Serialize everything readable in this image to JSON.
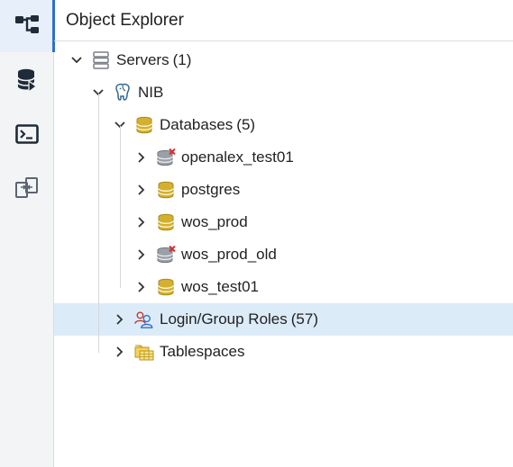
{
  "rail": {
    "buttons": [
      {
        "name": "object-explorer-icon",
        "active": true
      },
      {
        "name": "query-database-icon",
        "active": false
      },
      {
        "name": "terminal-icon",
        "active": false
      },
      {
        "name": "schema-diff-icon",
        "active": false
      }
    ]
  },
  "panel": {
    "title": "Object Explorer"
  },
  "tree": {
    "servers": {
      "label": "Servers",
      "count": "(1)"
    },
    "server": {
      "label": "NIB"
    },
    "databases": {
      "label": "Databases",
      "count": "(5)"
    },
    "db_items": [
      {
        "label": "openalex_test01",
        "disconnected": true
      },
      {
        "label": "postgres",
        "disconnected": false
      },
      {
        "label": "wos_prod",
        "disconnected": false
      },
      {
        "label": "wos_prod_old",
        "disconnected": true
      },
      {
        "label": "wos_test01",
        "disconnected": false
      }
    ],
    "roles": {
      "label": "Login/Group Roles",
      "count": "(57)"
    },
    "tablespaces": {
      "label": "Tablespaces"
    }
  },
  "colors": {
    "accent": "#2f6fcf",
    "selected_row": "#dcebf8",
    "db_gold": "#c9a227",
    "db_gray": "#8a8f98",
    "error_red": "#d32f2f"
  }
}
